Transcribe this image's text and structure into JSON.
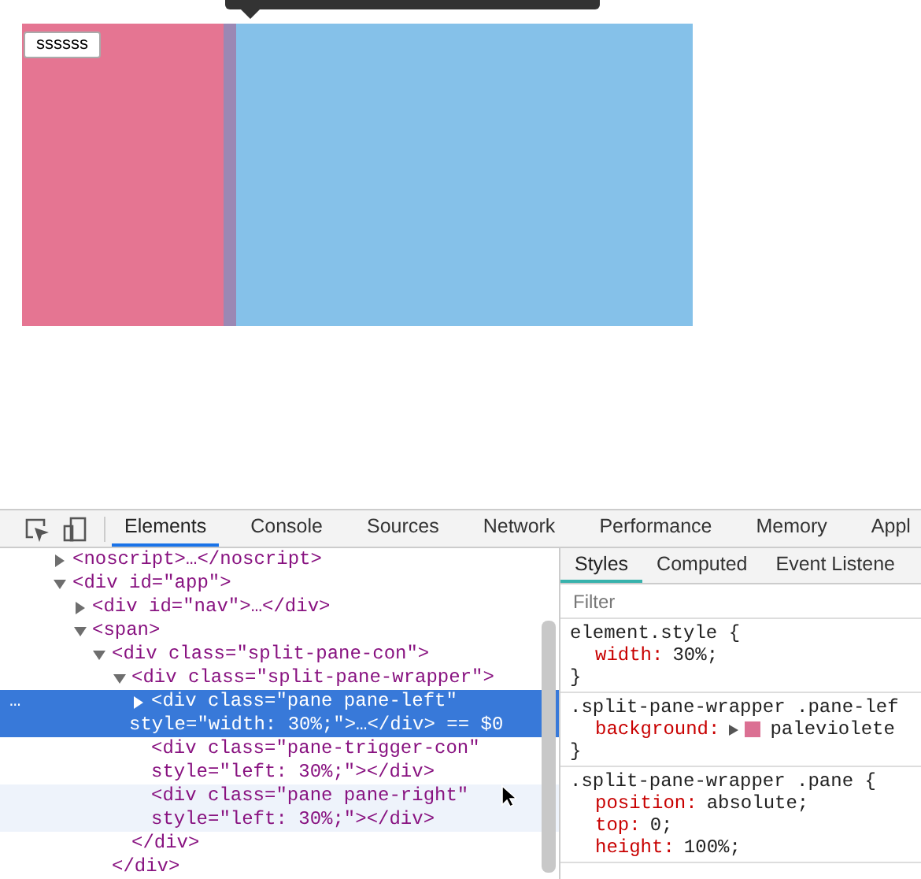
{
  "demo": {
    "button": "ssssss"
  },
  "devtools": {
    "tabs": [
      {
        "label": "Elements",
        "selected": true
      },
      {
        "label": "Console",
        "selected": false
      },
      {
        "label": "Sources",
        "selected": false
      },
      {
        "label": "Network",
        "selected": false
      },
      {
        "label": "Performance",
        "selected": false
      },
      {
        "label": "Memory",
        "selected": false
      },
      {
        "label": "Appl",
        "selected": false
      }
    ],
    "dom_tree": [
      {
        "lines": [
          "<noscript>…</noscript>"
        ],
        "kind": "parent",
        "expanded": false,
        "selected": false,
        "hovered": false
      },
      {
        "lines": [
          "<div id=\"app\">"
        ],
        "kind": "parent",
        "expanded": true,
        "selected": false,
        "hovered": false,
        "children": [
          {
            "lines": [
              "<div id=\"nav\">…</div>"
            ],
            "kind": "parent",
            "expanded": false,
            "selected": false,
            "hovered": false
          },
          {
            "lines": [
              "<span>"
            ],
            "kind": "parent",
            "expanded": true,
            "selected": false,
            "hovered": false,
            "children": [
              {
                "lines": [
                  "<div class=\"split-pane-con\">"
                ],
                "kind": "parent",
                "expanded": true,
                "selected": false,
                "hovered": false,
                "closing": "</div>",
                "children": [
                  {
                    "lines": [
                      "<div class=\"split-pane-wrapper\">"
                    ],
                    "kind": "parent",
                    "expanded": true,
                    "selected": false,
                    "hovered": false,
                    "closing": "</div>",
                    "children": [
                      {
                        "lines": [
                          "<div class=\"pane pane-left\"",
                          "style=\"width: 30%;\">…</div> == $0"
                        ],
                        "kind": "parent",
                        "expanded": false,
                        "selected": true,
                        "hovered": false,
                        "marker": "…"
                      },
                      {
                        "lines": [
                          "<div class=\"pane-trigger-con\"",
                          "style=\"left: 30%;\"></div>"
                        ],
                        "kind": "leaf",
                        "selected": false,
                        "hovered": false
                      },
                      {
                        "lines": [
                          "<div class=\"pane pane-right\"",
                          "style=\"left: 30%;\"></div>"
                        ],
                        "kind": "leaf",
                        "selected": false,
                        "hovered": true
                      }
                    ]
                  }
                ]
              }
            ]
          }
        ]
      }
    ],
    "side_tabs": [
      {
        "label": "Styles",
        "selected": true
      },
      {
        "label": "Computed",
        "selected": false
      },
      {
        "label": "Event Listene",
        "selected": false
      }
    ],
    "filter": {
      "placeholder": "Filter"
    },
    "rules": [
      {
        "selector": "element.style {",
        "declarations": [
          {
            "property": "width:",
            "value": "30%;"
          }
        ],
        "close": "}"
      },
      {
        "selector": ".split-pane-wrapper .pane-lef",
        "declarations": [
          {
            "property": "background:",
            "value": "paleviolete",
            "color": "#db7093"
          }
        ],
        "close": "}"
      },
      {
        "selector": ".split-pane-wrapper .pane {",
        "declarations": [
          {
            "property": "position:",
            "value": "absolute;"
          },
          {
            "property": "top:",
            "value": "0;"
          },
          {
            "property": "height:",
            "value": "100%;"
          }
        ]
      }
    ]
  }
}
